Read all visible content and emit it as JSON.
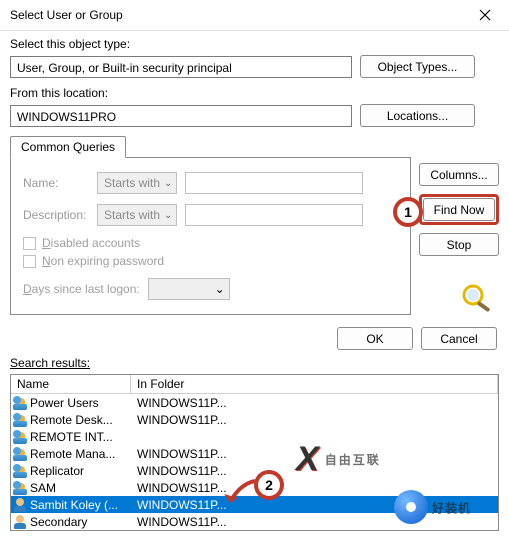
{
  "title": "Select User or Group",
  "objectType": {
    "label": "Select this object type:",
    "value": "User, Group, or Built-in security principal",
    "button": "Object Types..."
  },
  "fromLocation": {
    "label": "From this location:",
    "value": "WINDOWS11PRO",
    "button": "Locations..."
  },
  "tab": "Common Queries",
  "queries": {
    "nameLabel": "Name:",
    "nameMode": "Starts with",
    "descLabel": "Description:",
    "descMode": "Starts with",
    "disabled": "isabled accounts",
    "nonExpiring": "on expiring password",
    "daysLabel": "Days since last logon:"
  },
  "sideButtons": {
    "columns": "Columns...",
    "findNow": "Find Now",
    "stop": "Stop"
  },
  "bottom": {
    "ok": "OK",
    "cancel": "Cancel"
  },
  "searchResultsLabel": "Search results:",
  "columns": {
    "name": "Name",
    "folder": "In Folder"
  },
  "rows": [
    {
      "name": "Power Users",
      "folder": "WINDOWS11P...",
      "icon": "group"
    },
    {
      "name": "Remote Desk...",
      "folder": "WINDOWS11P...",
      "icon": "group"
    },
    {
      "name": "REMOTE INT...",
      "folder": "",
      "icon": "group"
    },
    {
      "name": "Remote Mana...",
      "folder": "WINDOWS11P...",
      "icon": "group"
    },
    {
      "name": "Replicator",
      "folder": "WINDOWS11P...",
      "icon": "group"
    },
    {
      "name": "SAM",
      "folder": "WINDOWS11P...",
      "icon": "group"
    },
    {
      "name": "Sambit Koley (...",
      "folder": "WINDOWS11P...",
      "icon": "user",
      "selected": true
    },
    {
      "name": "Secondary",
      "folder": "WINDOWS11P...",
      "icon": "user"
    }
  ],
  "annotations": {
    "one": "1",
    "two": "2"
  },
  "watermark1": "自由互联",
  "watermark2": "好装机"
}
